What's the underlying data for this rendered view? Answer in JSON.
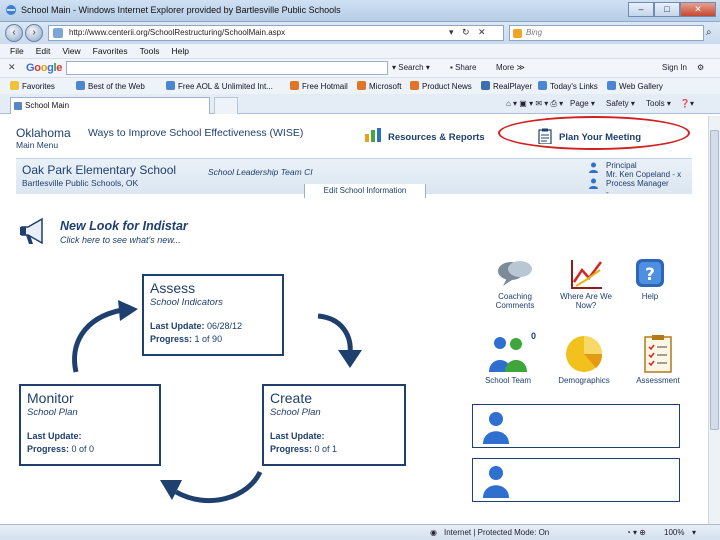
{
  "window": {
    "title": "School Main - Windows Internet Explorer provided by Bartlesville Public Schools",
    "controls": [
      "–",
      "□",
      "✕"
    ]
  },
  "address_bar": {
    "url": "http://www.centerii.org/SchoolRestructuring/SchoolMain.aspx",
    "search_placeholder": "Bing"
  },
  "menu": [
    "File",
    "Edit",
    "View",
    "Favorites",
    "Tools",
    "Help"
  ],
  "google_toolbar": {
    "logo": [
      "G",
      "o",
      "o",
      "g",
      "l",
      "e"
    ],
    "search_label": "Search",
    "share_label": "Share",
    "more_label": "More ≫",
    "signin_label": "Sign In"
  },
  "favorites_bar": {
    "favorites_label": "Favorites",
    "items": [
      "Best of the Web",
      "Free AOL & Unlimited Int...",
      "Free Hotmail",
      "Microsoft",
      "Product News",
      "RealPlayer",
      "Today's Links",
      "Web Gallery"
    ]
  },
  "tab": {
    "label": "School Main"
  },
  "command_bar": [
    "Page ▾",
    "Safety ▾",
    "Tools ▾",
    "?"
  ],
  "header": {
    "state": "Oklahoma",
    "main_menu": "Main Menu",
    "program": "Ways to Improve School Effectiveness (WISE)",
    "resources_link": "Resources & Reports",
    "plan_link": "Plan Your Meeting"
  },
  "school": {
    "name": "Oak Park Elementary School",
    "team": "School Leadership Team CI",
    "district": "Bartlesville Public Schools, OK",
    "edit_button": "Edit School Information",
    "principal_label": "Principal",
    "principal_name": "Mr. Ken Copeland - x",
    "process_manager_label": "Process Manager",
    "process_manager_name": "-"
  },
  "announcement": {
    "title": "New Look for Indistar",
    "subtitle": "Click here to see what's new..."
  },
  "cycle": {
    "assess": {
      "title": "Assess",
      "subtitle": "School Indicators",
      "last_update_label": "Last Update:",
      "last_update_value": "06/28/12",
      "progress_label": "Progress:",
      "progress_value": "1 of 90"
    },
    "monitor": {
      "title": "Monitor",
      "subtitle": "School Plan",
      "last_update_label": "Last Update:",
      "last_update_value": "",
      "progress_label": "Progress:",
      "progress_value": "0 of 0"
    },
    "create": {
      "title": "Create",
      "subtitle": "School Plan",
      "last_update_label": "Last Update:",
      "last_update_value": "",
      "progress_label": "Progress:",
      "progress_value": "0 of 1"
    }
  },
  "tiles": {
    "coaching": "Coaching Comments",
    "where": "Where Are We Now?",
    "help": "Help",
    "team": "School Team",
    "team_count": "0",
    "demographics": "Demographics",
    "assessment": "Assessment"
  },
  "status_bar": {
    "zone": "Internet | Protected Mode: On",
    "zoom": "100%"
  },
  "colors": {
    "navy": "#1f3f6e",
    "highlight_red": "#d21f1f"
  }
}
